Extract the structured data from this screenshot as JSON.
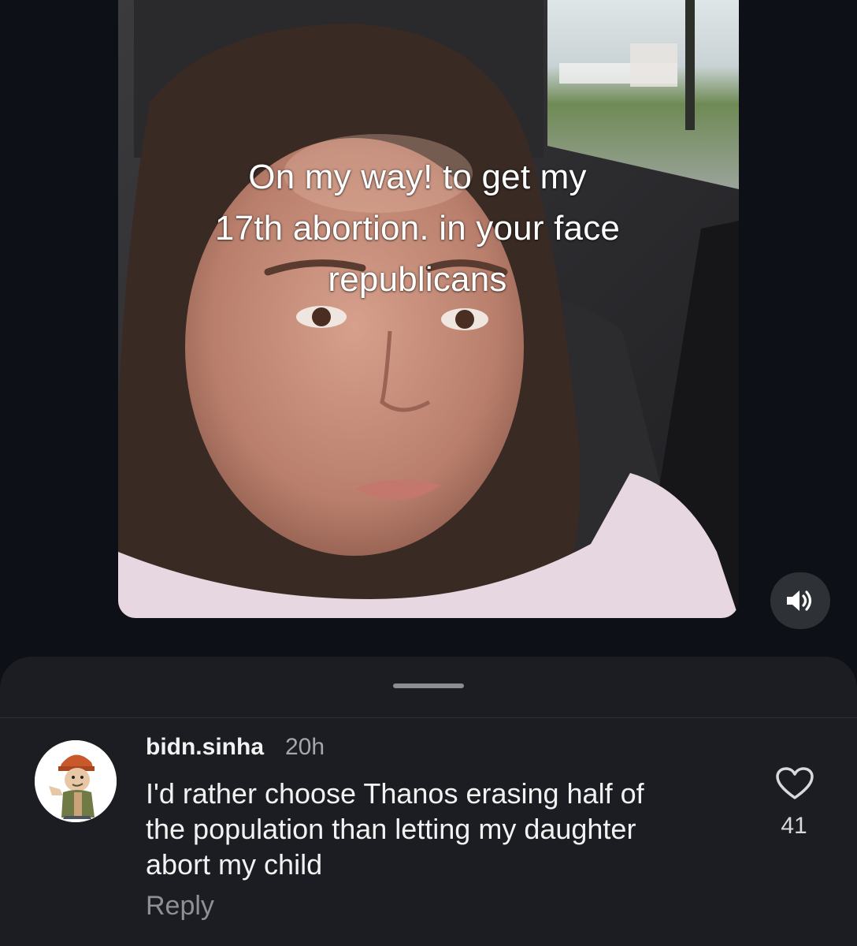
{
  "video": {
    "caption_lines": [
      "On my way! to get my",
      "17th abortion. in your face",
      "republicans"
    ],
    "sound_icon": "speaker-volume-icon"
  },
  "comment": {
    "author": "bidn.sinha",
    "time": "20h",
    "body_lines": [
      "I'd rather choose Thanos erasing half of",
      "the population than letting my daughter",
      "abort my child"
    ],
    "reply_label": "Reply",
    "like_icon": "heart-icon",
    "like_count": "41"
  },
  "colors": {
    "background": "#0d1017",
    "sheet": "#1b1d22",
    "text_primary": "#f2f2f2",
    "text_secondary": "#a5a7ab"
  }
}
